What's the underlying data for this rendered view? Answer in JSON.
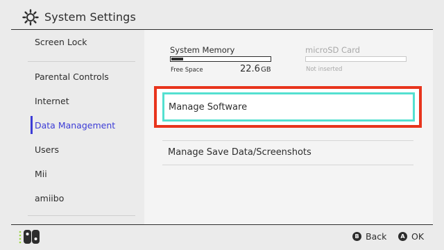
{
  "header": {
    "title": "System Settings",
    "icon": "gear-icon"
  },
  "sidebar": {
    "items": [
      {
        "label": "Screen Lock"
      },
      {
        "label": "Parental Controls"
      },
      {
        "label": "Internet"
      },
      {
        "label": "Data Management"
      },
      {
        "label": "Users"
      },
      {
        "label": "Mii"
      },
      {
        "label": "amiibo"
      }
    ],
    "active_index": 3
  },
  "storage": {
    "system_memory": {
      "label": "System Memory",
      "free_label": "Free Space",
      "free_value": "22.6",
      "free_unit": "GB",
      "used_fraction": 0.12
    },
    "microsd": {
      "label": "microSD Card",
      "status": "Not inserted"
    }
  },
  "main": {
    "manage_software": "Manage Software",
    "manage_save_data": "Manage Save Data/Screenshots"
  },
  "footer": {
    "back_button_glyph": "B",
    "back_label": "Back",
    "ok_button_glyph": "A",
    "ok_label": "OK"
  },
  "colors": {
    "accent": "#3c3cd6",
    "selection_outline": "#54e0d0",
    "highlight_frame": "#e8341c"
  }
}
